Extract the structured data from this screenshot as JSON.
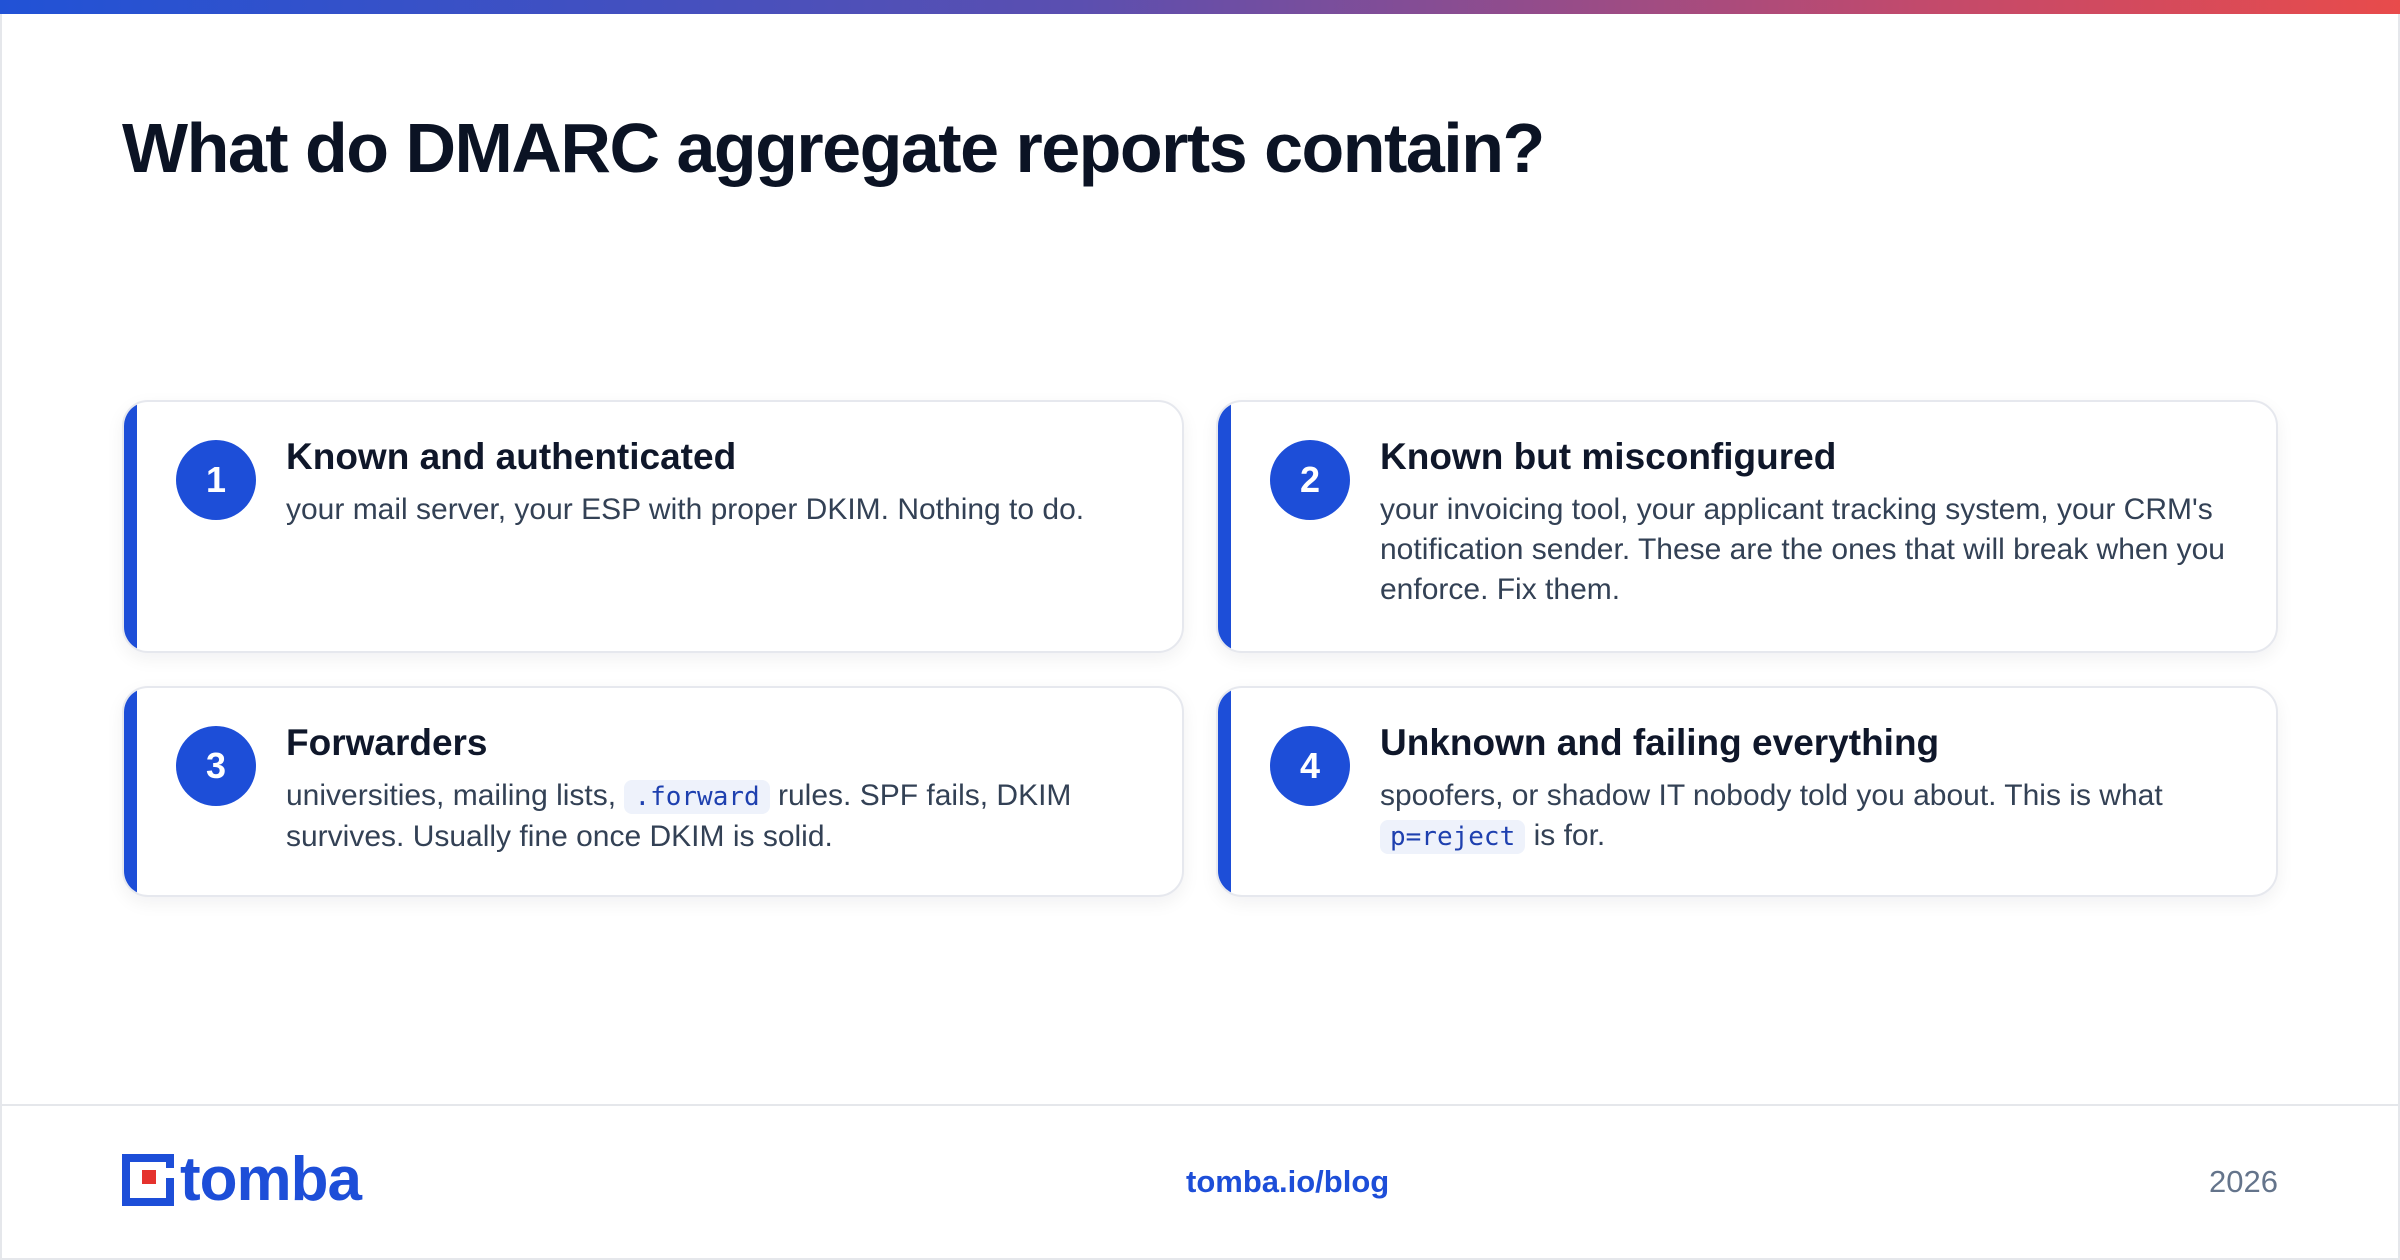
{
  "header": {
    "title": "What do DMARC aggregate reports contain?"
  },
  "cards": [
    {
      "number": "1",
      "title": "Known and authenticated",
      "body": "your mail server, your ESP with proper DKIM. Nothing to do."
    },
    {
      "number": "2",
      "title": "Known but misconfigured",
      "body": "your invoicing tool, your applicant tracking system, your CRM's notification sender. These are the ones that will break when you enforce. Fix them."
    },
    {
      "number": "3",
      "title": "Forwarders",
      "body_before": "universities, mailing lists, ",
      "code": ".forward",
      "body_after": " rules. SPF fails, DKIM survives. Usually fine once DKIM is solid."
    },
    {
      "number": "4",
      "title": "Unknown and failing everything",
      "body_before": "spoofers, or shadow IT nobody told you about. This is what ",
      "code": "p=reject",
      "body_after": " is for."
    }
  ],
  "footer": {
    "logo_text": "tomba",
    "link": "tomba.io/blog",
    "year": "2026"
  },
  "colors": {
    "accent": "#1d4ed8",
    "gradient_start": "#2152d6",
    "gradient_end": "#e84b4b",
    "logo_red": "#e5322d"
  }
}
